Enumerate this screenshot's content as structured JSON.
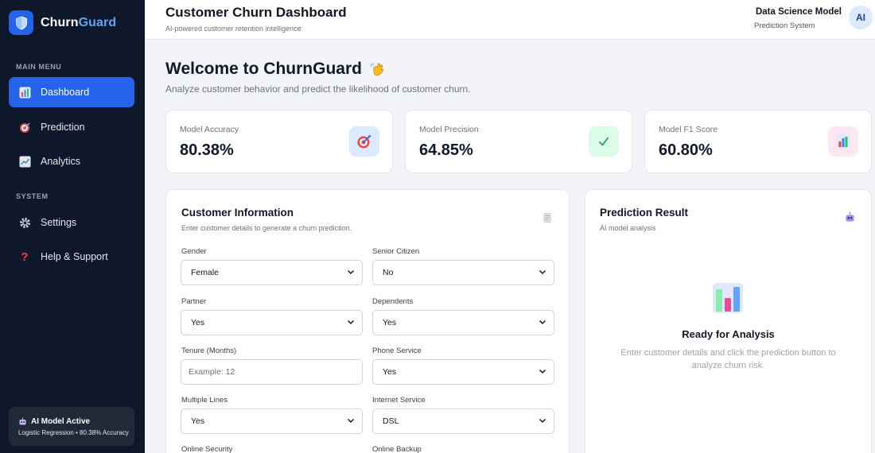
{
  "brand": {
    "name_main": "Churn",
    "name_accent": "Guard"
  },
  "sidebar": {
    "main_menu_label": "MAIN MENU",
    "system_label": "SYSTEM",
    "items": [
      {
        "label": "Dashboard",
        "icon": "bar-chart-icon",
        "active": true
      },
      {
        "label": "Prediction",
        "icon": "target-icon"
      },
      {
        "label": "Analytics",
        "icon": "line-chart-icon"
      },
      {
        "label": "Settings",
        "icon": "gear-icon"
      },
      {
        "label": "Help & Support",
        "icon": "question-icon"
      }
    ],
    "model_card": {
      "title": "AI Model Active",
      "subtitle": "Logistic Regression • 80.38% Accuracy"
    }
  },
  "header": {
    "title": "Customer Churn Dashboard",
    "subtitle": "AI-powered customer retention intelligence",
    "user_name": "Data Science Model",
    "user_role": "Prediction System",
    "avatar_initials": "AI"
  },
  "welcome": {
    "title": "Welcome to ChurnGuard",
    "subtitle": "Analyze customer behavior and predict the likelihood of customer churn."
  },
  "stats": [
    {
      "label": "Model Accuracy",
      "value": "80.38%",
      "icon": "target-icon",
      "bg": "#dbeafe"
    },
    {
      "label": "Model Precision",
      "value": "64.85%",
      "icon": "check-icon",
      "bg": "#dcfce7"
    },
    {
      "label": "Model F1 Score",
      "value": "60.80%",
      "icon": "bar-chart-icon",
      "bg": "#fce7f3"
    }
  ],
  "form": {
    "title": "Customer Information",
    "subtitle": "Enter customer details to generate a churn prediction.",
    "fields": {
      "gender": {
        "label": "Gender",
        "value": "Female"
      },
      "senior": {
        "label": "Senior Citizen",
        "value": "No"
      },
      "partner": {
        "label": "Partner",
        "value": "Yes"
      },
      "dependents": {
        "label": "Dependents",
        "value": "Yes"
      },
      "tenure": {
        "label": "Tenure (Months)",
        "placeholder": "Example: 12"
      },
      "phone": {
        "label": "Phone Service",
        "value": "Yes"
      },
      "multiple_lines": {
        "label": "Multiple Lines",
        "value": "Yes"
      },
      "internet": {
        "label": "Internet Service",
        "value": "DSL"
      },
      "online_security": {
        "label": "Online Security"
      },
      "online_backup": {
        "label": "Online Backup"
      }
    }
  },
  "result": {
    "title": "Prediction Result",
    "subtitle": "AI model analysis",
    "ready_title": "Ready for Analysis",
    "ready_text": "Enter customer details and click the prediction button to analyze churn risk."
  },
  "colors": {
    "sidebar_bg": "#0f172a",
    "accent": "#2563eb",
    "accent_light": "#60a5fa"
  }
}
